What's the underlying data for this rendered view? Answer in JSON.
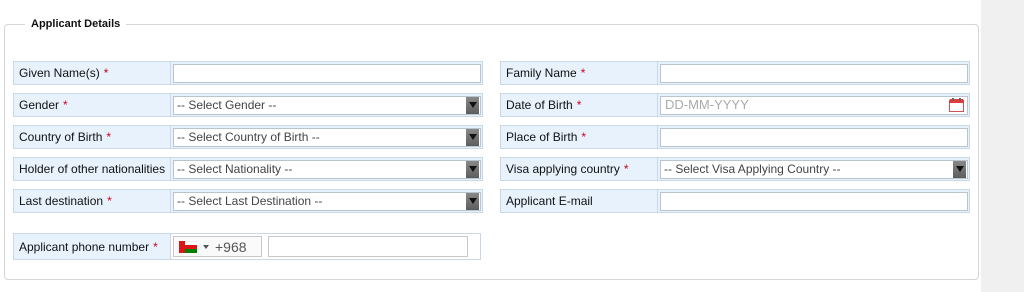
{
  "section": {
    "legend": "Applicant Details"
  },
  "fields": {
    "given_name": {
      "label": "Given Name(s)",
      "required": "*",
      "value": ""
    },
    "family_name": {
      "label": "Family Name",
      "required": "*",
      "value": ""
    },
    "gender": {
      "label": "Gender",
      "required": "*",
      "selected": "-- Select Gender --"
    },
    "date_of_birth": {
      "label": "Date of Birth",
      "required": "*",
      "placeholder": "DD-MM-YYYY",
      "icon": "calendar-icon"
    },
    "country_of_birth": {
      "label": "Country of Birth",
      "required": "*",
      "selected": "-- Select Country of Birth --"
    },
    "place_of_birth": {
      "label": "Place of Birth",
      "required": "*",
      "value": ""
    },
    "other_nationalities": {
      "label": "Holder of other nationalities",
      "selected": "-- Select Nationality --"
    },
    "visa_country": {
      "label": "Visa applying country",
      "required": "*",
      "selected": "-- Select Visa Applying Country --"
    },
    "last_destination": {
      "label": "Last destination",
      "required": "*",
      "selected": "-- Select Last Destination --"
    },
    "email": {
      "label": "Applicant E-mail",
      "value": ""
    },
    "phone": {
      "label": "Applicant phone number",
      "required": "*",
      "dial_code": "+968",
      "flag": "oman-flag-icon",
      "value": ""
    }
  },
  "colors": {
    "required": "#d0021b",
    "label_bg": "#e8f2fc",
    "border": "#c9d7e6"
  }
}
